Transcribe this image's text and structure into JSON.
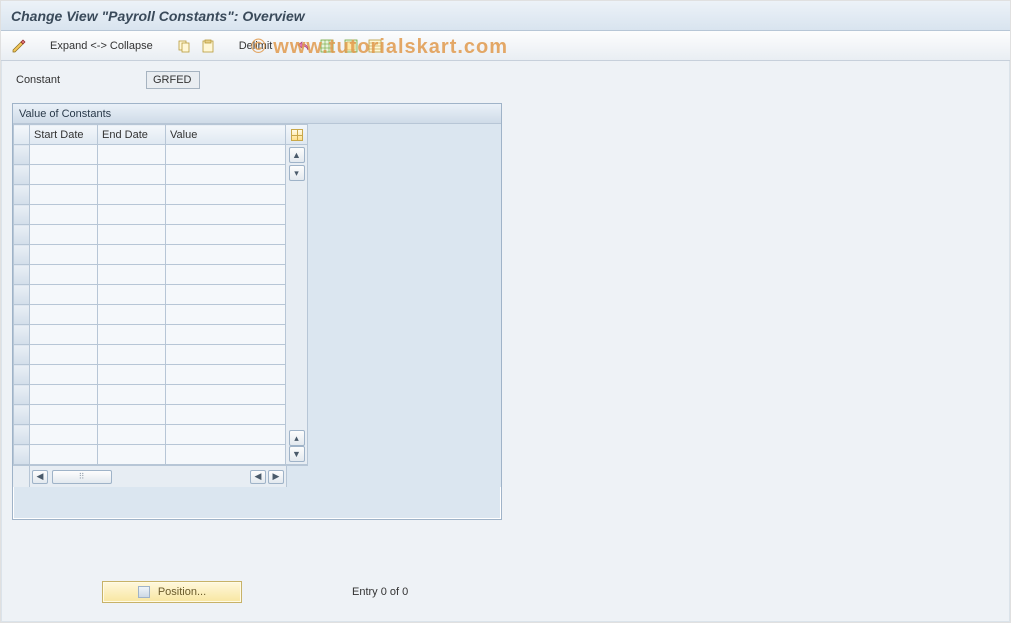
{
  "header": {
    "title": "Change View \"Payroll Constants\": Overview"
  },
  "toolbar": {
    "expand_collapse_label": "Expand <-> Collapse",
    "delimit_label": "Delimit"
  },
  "watermark": "© www.tutorialskart.com",
  "content": {
    "constant_label": "Constant",
    "constant_value": "GRFED"
  },
  "panel": {
    "title": "Value of Constants",
    "columns": {
      "start_date": "Start Date",
      "end_date": "End Date",
      "value": "Value"
    },
    "row_count": 16
  },
  "footer": {
    "position_label": "Position...",
    "entry_status": "Entry 0 of 0"
  }
}
